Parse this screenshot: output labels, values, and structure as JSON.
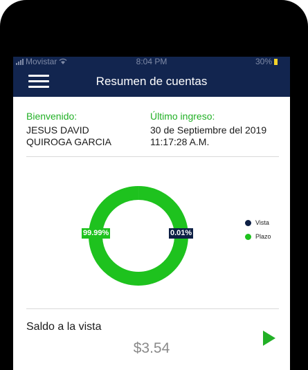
{
  "status_bar": {
    "carrier": "Movistar",
    "time": "8:04 PM",
    "battery": "30%"
  },
  "header": {
    "title": "Resumen de cuentas",
    "menu_icon": "hamburger-menu-icon"
  },
  "welcome": {
    "label": "Bienvenido:",
    "name": "JESUS  DAVID\nQUIROGA  GARCIA"
  },
  "last_login": {
    "label": "Último ingreso:",
    "date": "30 de Septiembre del 2019\n11:17:28 A.M."
  },
  "chart_data": {
    "type": "pie",
    "donut": true,
    "categories": [
      "Vista",
      "Plazo"
    ],
    "values": [
      0.01,
      99.99
    ],
    "labels": [
      "0.01%",
      "99.99%"
    ],
    "colors": [
      "#0d1f44",
      "#1ec21e"
    ],
    "legend_position": "right"
  },
  "balance": {
    "title": "Saldo a la vista",
    "amount": "$3.54",
    "play_icon": "play-icon"
  },
  "colors": {
    "navy": "#12254f",
    "green": "#22b026"
  }
}
